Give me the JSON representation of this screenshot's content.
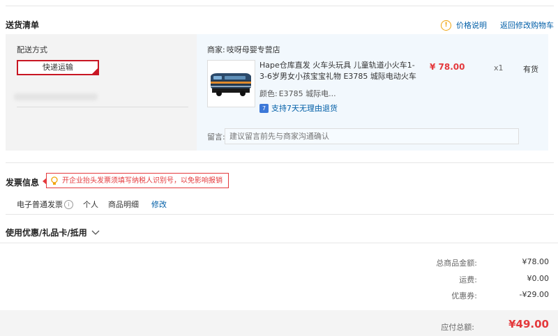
{
  "delivery": {
    "section_title": "送货清单",
    "price_note": "价格说明",
    "back_to_cart": "返回修改购物车",
    "method_label": "配送方式",
    "method_value": "快递运输"
  },
  "shop": {
    "label": "商家:",
    "name": "吱呀母婴专营店"
  },
  "item": {
    "name": "Hape仓库直发 火车头玩具 儿童轨道小火车1-3-6岁男女小孩宝宝礼物 E3785 城际电动火车",
    "price": "¥ 78.00",
    "quantity": "x1",
    "stock": "有货",
    "color_label": "颜色:",
    "color_value": "E3785 城际电...",
    "return_policy": "支持7天无理由退货",
    "return_badge": "7"
  },
  "message": {
    "label": "留言:",
    "placeholder": "建议留言前先与商家沟通确认"
  },
  "invoice": {
    "section_title": "发票信息",
    "tip": "开企业抬头发票须填写纳税人识别号，以免影响报销",
    "type": "电子普通发票",
    "title_type": "个人",
    "content": "商品明细",
    "edit": "修改"
  },
  "discount": {
    "section_title": "使用优惠/礼品卡/抵用"
  },
  "summary": {
    "goods_total_label": "总商品金额:",
    "goods_total": "¥78.00",
    "shipping_label": "运费:",
    "shipping": "¥0.00",
    "coupon_label": "优惠券:",
    "coupon": "-¥29.00",
    "payable_label": "应付总额:",
    "payable": "¥49.00"
  },
  "colors": {
    "accent_red": "#e4393c",
    "link_blue": "#005ea7",
    "tip_orange": "#f0a30a"
  }
}
